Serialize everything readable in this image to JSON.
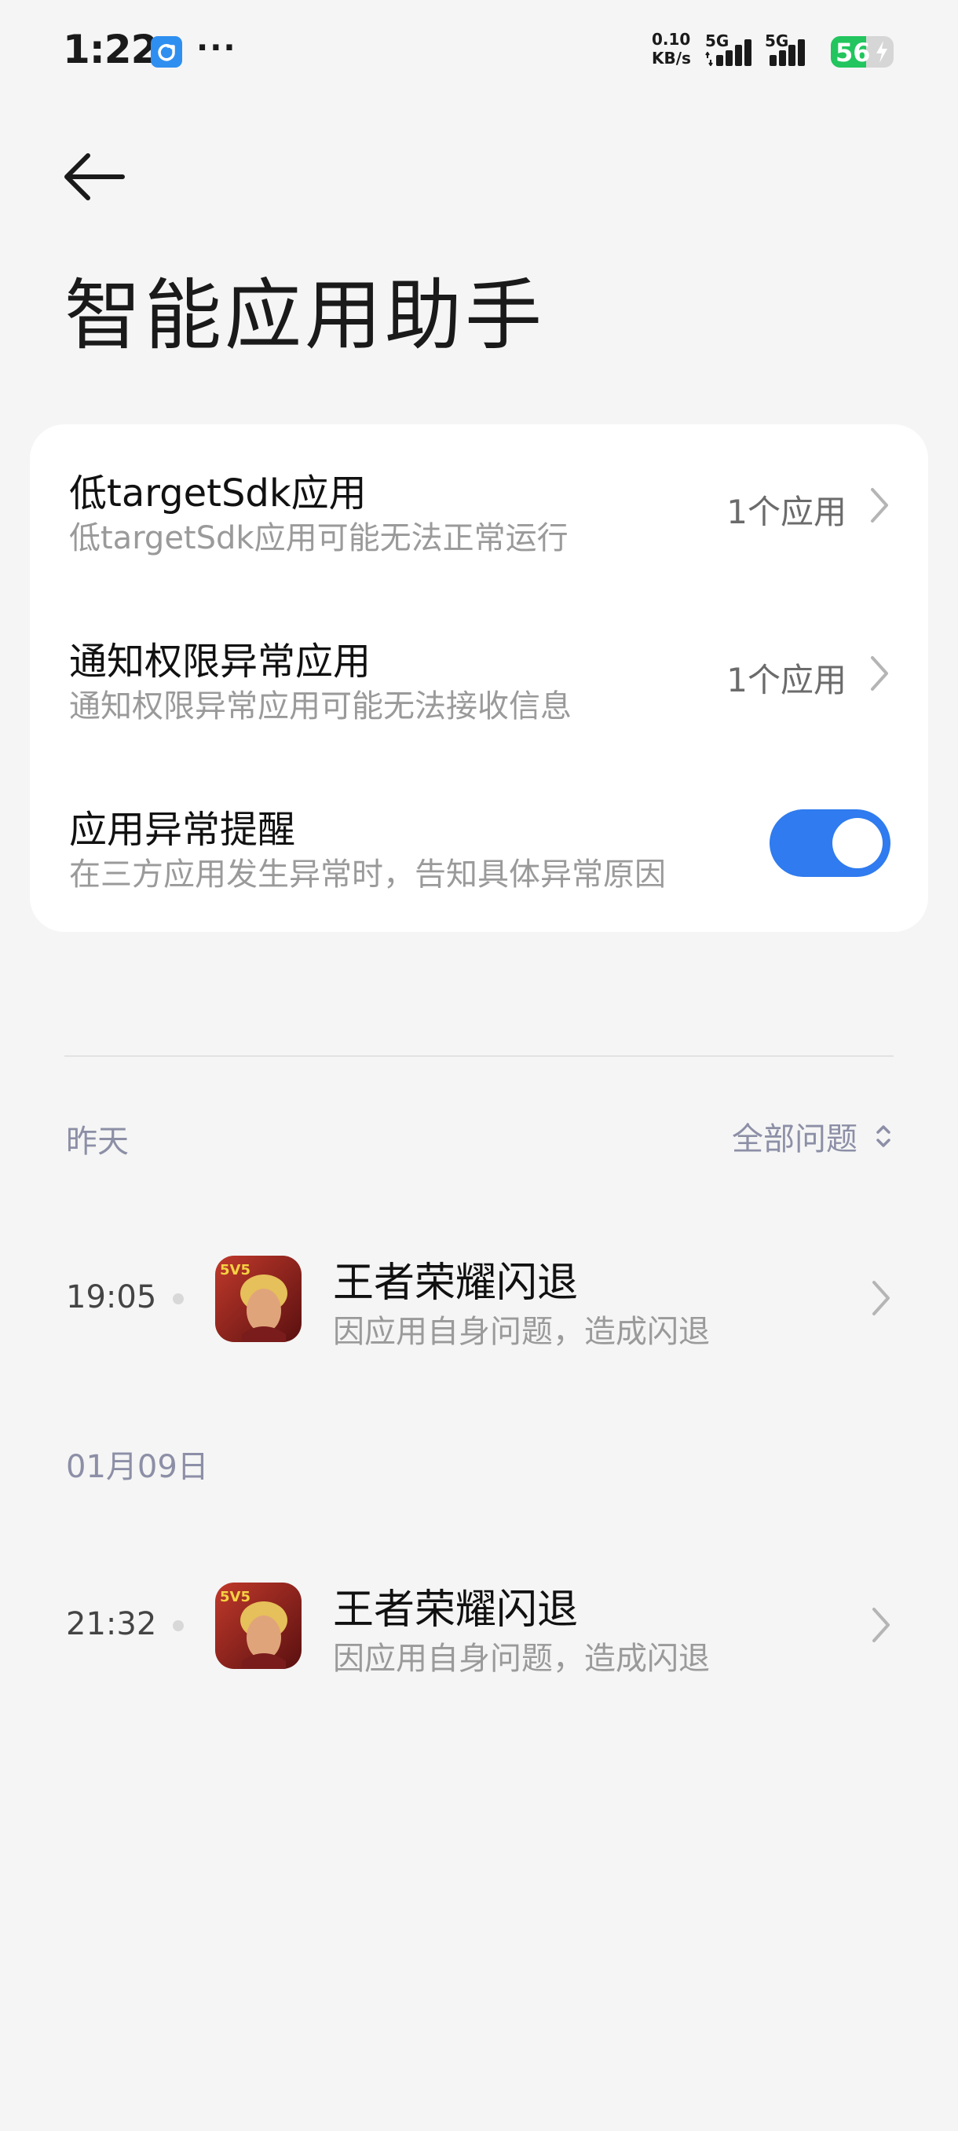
{
  "status_bar": {
    "time": "1:22",
    "app_icon": "sync-app-icon",
    "more": "···",
    "net_speed_value": "0.10",
    "net_speed_unit": "KB/s",
    "sim1_tag": "5G",
    "sim2_tag": "5G",
    "battery_level": "56",
    "battery_percent": 56,
    "accent_battery": "#22c55e"
  },
  "header": {
    "back_icon": "arrow-left-icon",
    "title": "智能应用助手"
  },
  "settings": {
    "items": [
      {
        "title": "低targetSdk应用",
        "subtitle": "低targetSdk应用可能无法正常运行",
        "value": "1个应用"
      },
      {
        "title": "通知权限异常应用",
        "subtitle": "通知权限异常应用可能无法接收信息",
        "value": "1个应用"
      },
      {
        "title": "应用异常提醒",
        "subtitle": "在三方应用发生异常时，告知具体异常原因",
        "toggle_on": true
      }
    ],
    "toggle_color": "#2f7bef"
  },
  "log": {
    "filter_label": "全部问题",
    "groups": [
      {
        "date": "昨天",
        "entries": [
          {
            "time": "19:05",
            "app": "王者荣耀闪退",
            "reason": "因应用自身问题，造成闪退"
          }
        ]
      },
      {
        "date": "01月09日",
        "entries": [
          {
            "time": "21:32",
            "app": "王者荣耀闪退",
            "reason": "因应用自身问题，造成闪退"
          }
        ]
      }
    ]
  }
}
